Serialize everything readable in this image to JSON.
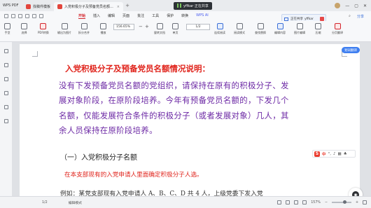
{
  "tabbar": {
    "brand": "WPS PDF",
    "tabs": [
      {
        "label": "找稿件模板",
        "color": "#e2453c",
        "active": false
      },
      {
        "label": "入党积极分子及预备党员名额...",
        "color": "#e2453c",
        "active": true
      }
    ],
    "share_chip": "yffkar 正在共享"
  },
  "menubar": {
    "items": [
      "开始",
      "插入",
      "编辑",
      "页面",
      "批注",
      "工具",
      "保护",
      "转换",
      "WPS AI"
    ],
    "active": "开始",
    "share": "分享"
  },
  "toolbar": {
    "tools": [
      {
        "label": "选择",
        "name": "select-tool"
      },
      {
        "label": "PDF转换",
        "name": "pdf-convert-tool"
      },
      {
        "label": "输出为图片",
        "name": "export-image-tool"
      },
      {
        "label": "拆分合并",
        "name": "split-merge-tool"
      },
      {
        "label": "播放",
        "name": "play-tool"
      },
      {
        "label": "旋转文档",
        "name": "rotate-tool"
      },
      {
        "label": "单页",
        "name": "single-page-tool"
      },
      {
        "label": "连续阅读",
        "name": "continuous-tool"
      },
      {
        "label": "阅读模式",
        "name": "read-mode-tool"
      },
      {
        "label": "查找替换",
        "name": "find-replace-tool"
      },
      {
        "label": "编辑内容",
        "name": "edit-content-tool"
      },
      {
        "label": "图片编辑",
        "name": "image-edit-tool"
      },
      {
        "label": "压缩",
        "name": "compress-tool"
      },
      {
        "label": "分页翻译",
        "name": "translate-tool"
      }
    ],
    "zoom": "156.65%",
    "page_indicator": "1/2",
    "hand_tool": "手型"
  },
  "document": {
    "heading": "入党积极分子及预备党员名额情况说明：",
    "paragraph_lines": [
      "没有下发预备党员名额的党组织，请保持在原有的积极分子、发",
      "展对象阶段，在原阶段培养。今年有预备党员名额的，下发几个",
      "名额，仅能发展符合条件的积极分子（或者发展对象）几人，其",
      "余人员保持在原阶段培养。"
    ],
    "subheading": "（一）入党积极分子名额",
    "note": "在本支部现有的入党申请人里面确定积极分子人选。",
    "example": "例如：某党支部现有入党申请人 A、B、C、D 共 4 人，上级党委下发入党"
  },
  "float": {
    "translate_pill": "划词翻译",
    "remote_label": "正在共享",
    "remote_user": "yffkar"
  },
  "statusbar": {
    "page": "1/2",
    "revision": "编辑模式",
    "zoom": "157%"
  }
}
